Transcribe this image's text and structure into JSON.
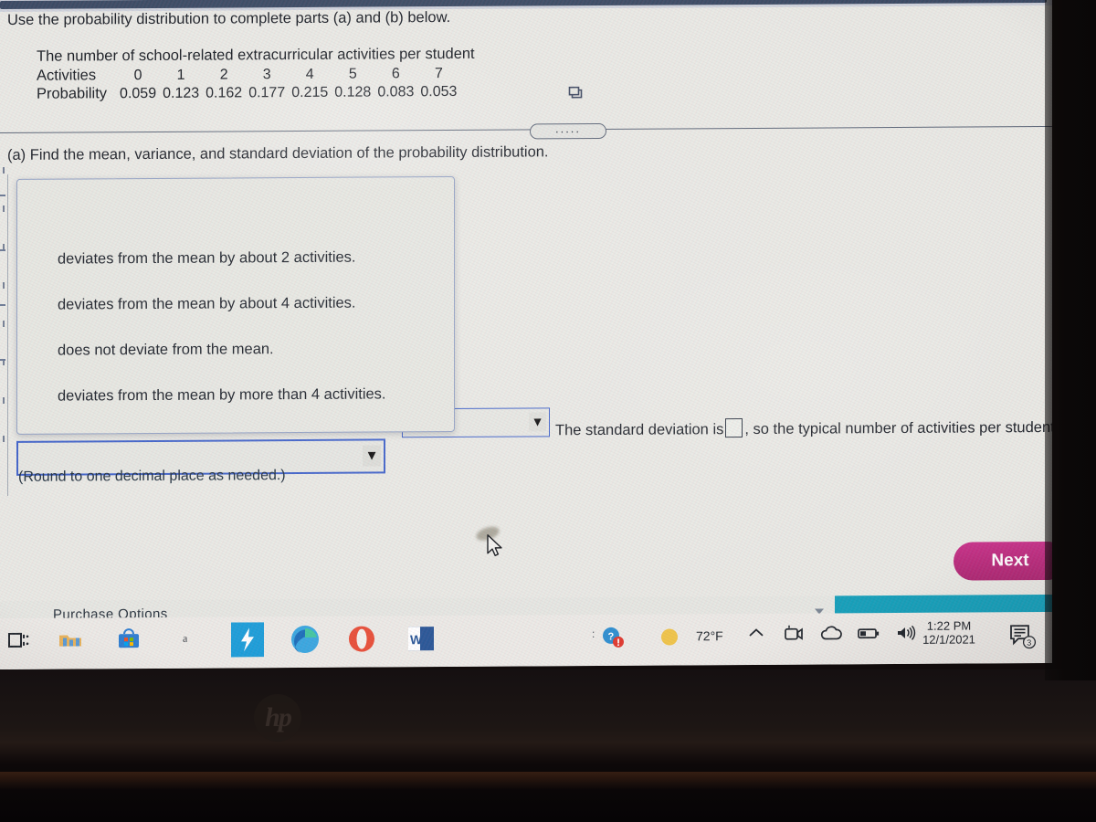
{
  "question": {
    "prompt": "Use the probability distribution to complete parts (a) and (b) below.",
    "table_title": "The number of school-related extracurricular activities per student",
    "row_labels": [
      "Activities",
      "Probability"
    ],
    "activities": [
      "0",
      "1",
      "2",
      "3",
      "4",
      "5",
      "6",
      "7"
    ],
    "probabilities": [
      "0.059",
      "0.123",
      "0.162",
      "0.177",
      "0.215",
      "0.128",
      "0.083",
      "0.053"
    ],
    "part_a": "(a) Find the mean, variance, and standard deviation of the probability distribution.",
    "popout_icon": "popout-window-icon",
    "ellipsis_label": "....."
  },
  "answer_area": {
    "sd_sentence_before": "The standard deviation is",
    "sd_sentence_after": ", so the typical number of activities per student",
    "round_note": "(Round to one decimal place as needed.)",
    "combo_left_value": "",
    "combo_right_value": "",
    "dropdown_arrow": "▼"
  },
  "dropdown": {
    "options": [
      "deviates from the mean by about 2 activities.",
      "deviates from the mean by about 4 activities.",
      "does not deviate from the mean.",
      "deviates from the mean by more than 4 activities."
    ]
  },
  "footer": {
    "next_label": "Next",
    "purchase_options": "Purchase Options"
  },
  "taskbar": {
    "icons": [
      "task-view-icon",
      "file-explorer-icon",
      "microsoft-store-icon",
      "acrobat-icon",
      "power-automate-icon",
      "microsoft-edge-icon",
      "opera-icon",
      "microsoft-word-icon"
    ],
    "weather_temp": "72°F",
    "system_icons": [
      "help-alert-icon",
      "chevron-up-icon",
      "camera-icon",
      "onedrive-icon",
      "battery-icon",
      "volume-icon"
    ],
    "time": "1:22 PM",
    "date": "12/1/2021",
    "notification_count": "3"
  },
  "device": {
    "brand_logo": "hp"
  },
  "colors": {
    "accent_pink": "#bb2e7e",
    "focus_blue": "#3f62c9",
    "teal_strip": "#18a0ba",
    "screen_bg": "#e9e9e4",
    "chrome_navy": "#3b4a63"
  }
}
